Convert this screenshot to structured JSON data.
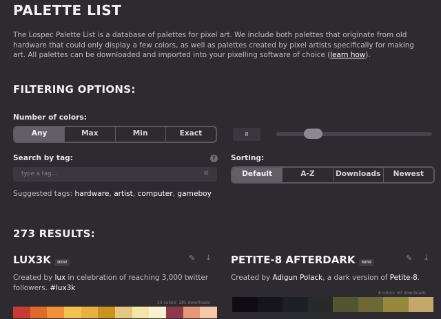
{
  "page": {
    "title": "PALETTE LIST",
    "intro_prefix": "The Lospec Palette List is a database of palettes for pixel art. We include both palettes that originate from old hardware that could only display a few colors, as well as palettes created by pixel artists specifically for making art. All palettes can be downloaded and imported into your pixelling software of choice (",
    "intro_link": "learn how",
    "intro_suffix": ")."
  },
  "filters": {
    "heading": "FILTERING OPTIONS:",
    "colors_label": "Number of colors:",
    "color_modes": [
      "Any",
      "Max",
      "Min",
      "Exact"
    ],
    "color_count": "8",
    "slider_level": 0.25,
    "tag_label": "Search by tag:",
    "tag_placeholder": "type a tag...",
    "suggested_label": "Suggested tags:",
    "suggested_tags": [
      "hardware",
      "artist",
      "computer",
      "gameboy"
    ],
    "sorting_label": "Sorting:",
    "sort_modes": [
      "Default",
      "A-Z",
      "Downloads",
      "Newest"
    ]
  },
  "results": {
    "heading": "273 RESULTS:",
    "palettes": [
      {
        "title": "LUX3K",
        "badge": "NEW",
        "desc_a": "Created by ",
        "author": "lux",
        "desc_b": " in celebration of reaching 3,000 twitter followers. ",
        "tag": "#lux3k",
        "meta_colors": "36 colors",
        "meta_downloads": "185 downloads",
        "colors": [
          "#c83a34",
          "#e06a2c",
          "#f0913a",
          "#f3c351",
          "#e8b040",
          "#c8941e",
          "#e4c880",
          "#f3e6a8",
          "#f8f2cc",
          "#8c3a48",
          "#e89878",
          "#f4c8a8"
        ]
      },
      {
        "title": "PETITE-8 AFTERDARK",
        "badge": "NEW",
        "desc_a": "Created by ",
        "author": "Adigun Polack",
        "desc_b": ", a dark version of ",
        "link": "Petite-8",
        "desc_c": ".",
        "meta_colors": "8 colors",
        "meta_downloads": "67 downloads",
        "colors": [
          "#0e0d14",
          "#14151e",
          "#1c2026",
          "#262b2a",
          "#515530",
          "#6c6838",
          "#98873e",
          "#c4a86a"
        ]
      }
    ]
  }
}
